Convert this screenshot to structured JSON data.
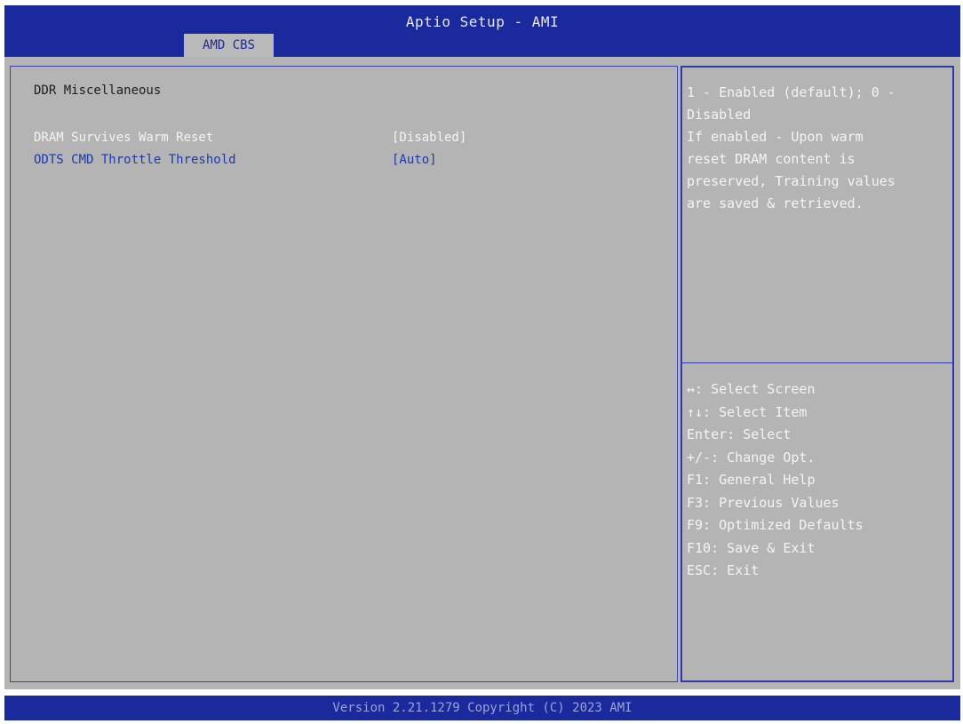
{
  "header": {
    "title": "Aptio Setup - AMI",
    "tab_label": "AMD CBS"
  },
  "main": {
    "section_title": "DDR Miscellaneous",
    "items": [
      {
        "label": "DRAM Survives Warm Reset",
        "value": "[Disabled]",
        "selected": true
      },
      {
        "label": "ODTS CMD Throttle Threshold",
        "value": "[Auto]",
        "selected": false
      }
    ]
  },
  "help": {
    "lines": [
      "1 - Enabled (default); 0 -",
      "Disabled",
      "If enabled - Upon warm",
      "reset DRAM content is",
      "preserved, Training values",
      "are saved & retrieved."
    ]
  },
  "keys": {
    "lines": [
      "↔: Select Screen",
      "↑↓: Select Item",
      "Enter: Select",
      "+/-: Change Opt.",
      "F1: General Help",
      "F3: Previous Values",
      "F9: Optimized Defaults",
      "F10: Save & Exit",
      "ESC: Exit"
    ]
  },
  "footer": {
    "version": "Version 2.21.1279 Copyright (C) 2023 AMI"
  },
  "colors": {
    "header_bg": "#1a2a9c",
    "body_bg": "#b4b4b4",
    "selected_text": "#f4f4f4",
    "item_text": "#1c3ab0"
  }
}
